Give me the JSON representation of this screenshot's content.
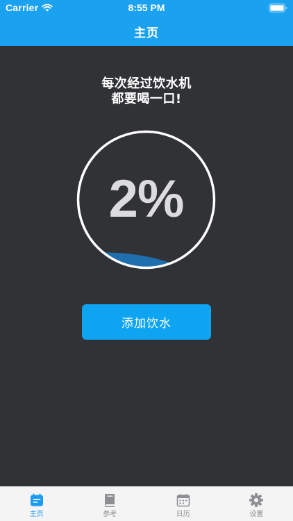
{
  "status_bar": {
    "carrier": "Carrier",
    "time": "8:55 PM",
    "wifi_icon": "wifi-icon",
    "battery_icon": "battery-icon"
  },
  "nav": {
    "title": "主页"
  },
  "main": {
    "slogan_lines": [
      "每次经过饮水机",
      "都要喝一口!"
    ],
    "progress": {
      "value": 2,
      "label": "2%"
    },
    "add_button_label": "添加饮水"
  },
  "tabbar": {
    "items": [
      {
        "label": "主页",
        "icon": "home-note-icon",
        "active": true
      },
      {
        "label": "参考",
        "icon": "book-icon",
        "active": false
      },
      {
        "label": "日历",
        "icon": "calendar-icon",
        "active": false
      },
      {
        "label": "设置",
        "icon": "gear-icon",
        "active": false
      }
    ]
  },
  "colors": {
    "accent": "#1aa1f0",
    "background": "#303236",
    "water": "#1f6fae",
    "tab_inactive": "#8e8e93",
    "tab_active": "#1a9bf0"
  }
}
